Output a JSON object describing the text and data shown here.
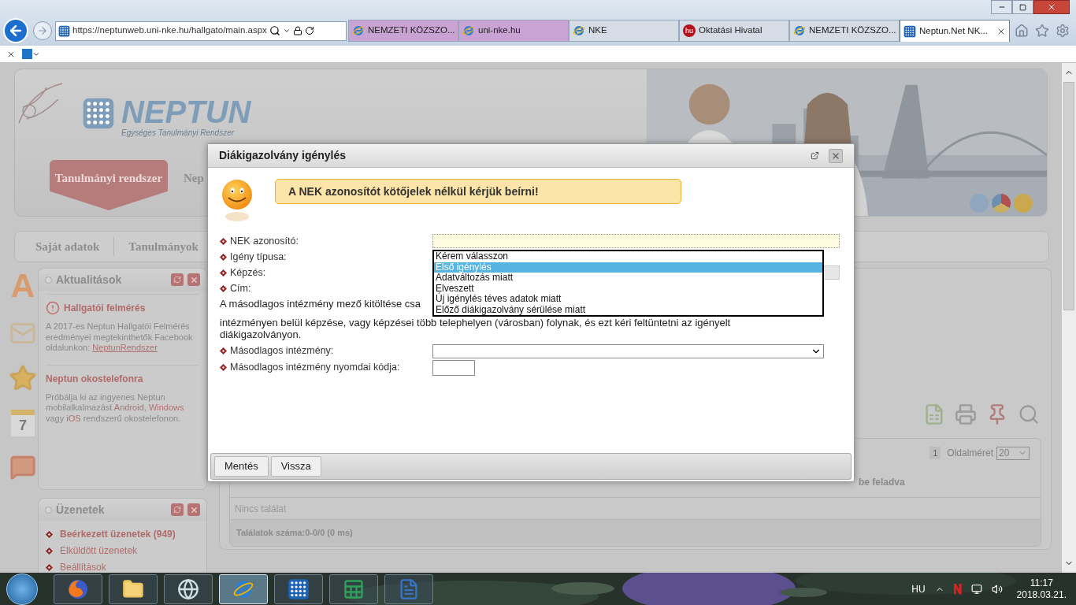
{
  "browser": {
    "address": "https://neptunweb.uni-nke.hu/hallgato/main.aspx",
    "tabs": [
      {
        "label": "NEMZETI KÖZSZO...",
        "kind": "ie",
        "color": "#c9a3d3",
        "selected": false
      },
      {
        "label": "uni-nke.hu",
        "kind": "ie",
        "color": "#c9a3d3",
        "selected": false
      },
      {
        "label": "NKE",
        "kind": "ie",
        "color": "#d5dce6",
        "selected": false
      },
      {
        "label": "Oktatási Hivatal",
        "kind": "badge",
        "badge": "hu",
        "color": "#d5dce6",
        "selected": false
      },
      {
        "label": "NEMZETI KÖZSZO...",
        "kind": "ie",
        "color": "#d5dce6",
        "selected": false
      },
      {
        "label": "Neptun.Net NK...",
        "kind": "neptun",
        "color": "#ffffff",
        "selected": true
      }
    ]
  },
  "header": {
    "logo": "NEPTUN",
    "tagline": "Egységes Tanulmányi Rendszer",
    "tabs": [
      {
        "label": "Tanulmányi rendszer",
        "selected": true
      },
      {
        "label": "Nep",
        "selected": false
      }
    ]
  },
  "menu": [
    "Saját adatok",
    "Tanulmányok"
  ],
  "side_icons": {
    "letter": "A",
    "calendar_day": "7"
  },
  "news": {
    "title": "Aktualitások",
    "items": [
      {
        "title": "Hallgatói felmérés",
        "kind": "alert",
        "segments": [
          {
            "text": "A 2017-es Neptun Hallgatói Felmérés eredményei megtekinthetők Facebook oldalunkon: ",
            "kind": "text"
          },
          {
            "text": "NeptunRendszer",
            "kind": "underlined_link"
          }
        ]
      },
      {
        "title": "Neptun okostelefonra",
        "kind": "plain",
        "segments": [
          {
            "text": "Próbálja ki az ingyenes Neptun mobilalkalmazást ",
            "kind": "text"
          },
          {
            "text": "Android",
            "kind": "link"
          },
          {
            "text": ", ",
            "kind": "text"
          },
          {
            "text": "Windows",
            "kind": "link"
          },
          {
            "text": " vagy ",
            "kind": "text"
          },
          {
            "text": "iOS",
            "kind": "link"
          },
          {
            "text": " rendszerű okostelefonon.",
            "kind": "text"
          }
        ]
      }
    ]
  },
  "messages": {
    "title": "Üzenetek",
    "items": [
      {
        "label": "Beérkezett üzenetek (949)",
        "bold": true
      },
      {
        "label": "Elküldött üzenetek",
        "bold": false
      },
      {
        "label": "Beállítások",
        "bold": false
      }
    ]
  },
  "results": {
    "page": "1",
    "page_size_label": "Oldalméret",
    "page_size": "20",
    "column_header": "be feladva",
    "empty": "Nincs találat",
    "summary": "Találatok száma:0-0/0 (0 ms)"
  },
  "dialog": {
    "title": "Diákigazolvány igénylés",
    "hint": "A NEK azonosítót kötőjelek nélkül kérjük beírni!",
    "fields": [
      {
        "label": "NEK azonosító:",
        "kind": "text"
      },
      {
        "label": "Igény típusa:",
        "kind": "listbox",
        "options": [
          {
            "label": "Kérem válasszon",
            "selected": false
          },
          {
            "label": "Első igénylés",
            "selected": true
          },
          {
            "label": "Adatváltozás miatt",
            "selected": false
          },
          {
            "label": "Elveszett",
            "selected": false
          },
          {
            "label": "Új igénylés téves adatok miatt",
            "selected": false
          },
          {
            "label": "Előző diákigazolvány sérülése miatt",
            "selected": false
          }
        ]
      },
      {
        "label": "Képzés:",
        "kind": "disabled_select"
      },
      {
        "label": "Cím:",
        "kind": "none"
      }
    ],
    "note": [
      "A másodlagos intézmény mező kitöltése csa",
      "intézményen belül képzése, vagy képzései több telephelyen (városban) folynak, és ezt kéri feltüntetni az igényelt diákigazolványon."
    ],
    "extra_fields": [
      {
        "label": "Másodlagos intézmény:",
        "kind": "select"
      },
      {
        "label": "Másodlagos intézmény nyomdai kódja:",
        "kind": "short_text"
      }
    ],
    "buttons": [
      "Mentés",
      "Vissza"
    ]
  },
  "taskbar": {
    "apps": [
      {
        "kind": "firefox",
        "selected": false
      },
      {
        "kind": "folder",
        "selected": false
      },
      {
        "kind": "globe",
        "selected": false
      },
      {
        "kind": "ie",
        "selected": true
      },
      {
        "kind": "neptun",
        "selected": false
      },
      {
        "kind": "excel",
        "selected": false
      },
      {
        "kind": "word",
        "selected": false
      }
    ],
    "language": "HU",
    "time": "11:17",
    "date": "2018.03.21."
  }
}
